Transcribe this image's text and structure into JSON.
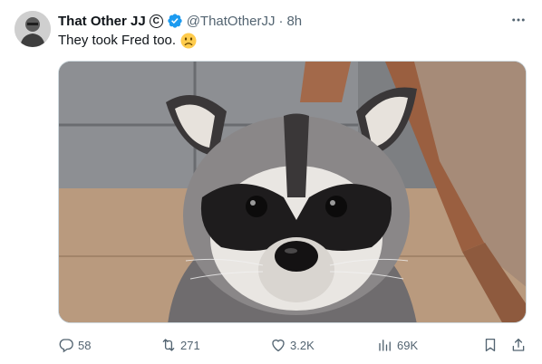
{
  "tweet": {
    "author_name": "That Other JJ",
    "author_badge_letter": "C",
    "handle": "@ThatOtherJJ",
    "separator": "·",
    "time": "8h",
    "text": "They took Fred too.",
    "emoji_name": "frowning-face-icon"
  },
  "actions": {
    "replies": "58",
    "retweets": "271",
    "likes": "3.2K",
    "views": "69K"
  },
  "colors": {
    "verified": "#1d9bf0",
    "muted": "#536471",
    "text": "#0f1419"
  }
}
